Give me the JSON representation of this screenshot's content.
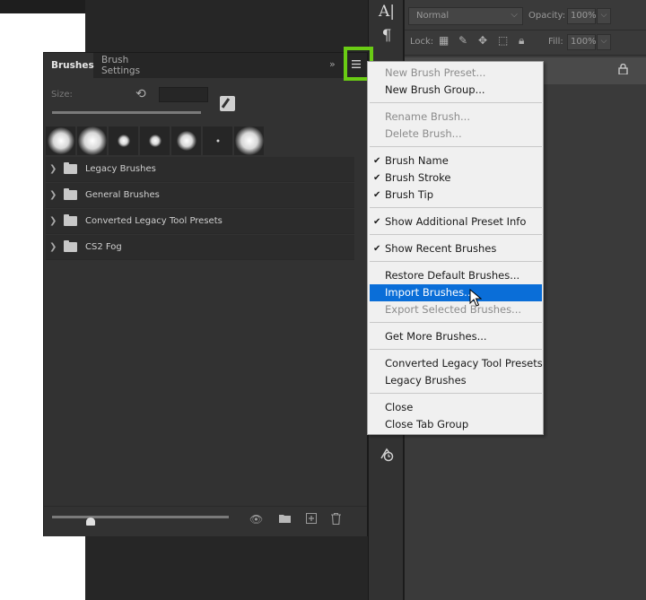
{
  "layers_panel": {
    "blend_mode": "Normal",
    "opacity_label": "Opacity:",
    "opacity_value": "100%",
    "lock_label": "Lock:",
    "fill_label": "Fill:",
    "fill_value": "100%"
  },
  "brushes_panel": {
    "tabs": [
      {
        "label": "Brushes",
        "active": true
      },
      {
        "label": "Brush Settings",
        "active": false
      }
    ],
    "size_label": "Size:",
    "size_value": "",
    "brush_groups": [
      {
        "label": "Legacy Brushes"
      },
      {
        "label": "General Brushes"
      },
      {
        "label": "Converted Legacy Tool Presets"
      },
      {
        "label": "CS2 Fog"
      }
    ]
  },
  "menu": {
    "items": [
      {
        "label": "New Brush Preset...",
        "enabled": false,
        "checked": false
      },
      {
        "label": "New Brush Group...",
        "enabled": true,
        "checked": false
      },
      {
        "label": "Rename Brush...",
        "enabled": false,
        "checked": false
      },
      {
        "label": "Delete Brush...",
        "enabled": false,
        "checked": false
      },
      {
        "label": "Brush Name",
        "enabled": true,
        "checked": true
      },
      {
        "label": "Brush Stroke",
        "enabled": true,
        "checked": true
      },
      {
        "label": "Brush Tip",
        "enabled": true,
        "checked": true
      },
      {
        "label": "Show Additional Preset Info",
        "enabled": true,
        "checked": true
      },
      {
        "label": "Show Recent Brushes",
        "enabled": true,
        "checked": true
      },
      {
        "label": "Restore Default Brushes...",
        "enabled": true,
        "checked": false
      },
      {
        "label": "Import Brushes...",
        "enabled": true,
        "checked": false,
        "highlighted": true
      },
      {
        "label": "Export Selected Brushes...",
        "enabled": false,
        "checked": false
      },
      {
        "label": "Get More Brushes...",
        "enabled": true,
        "checked": false
      },
      {
        "label": "Converted Legacy Tool Presets",
        "enabled": true,
        "checked": false
      },
      {
        "label": "Legacy Brushes",
        "enabled": true,
        "checked": false
      },
      {
        "label": "Close",
        "enabled": true,
        "checked": false
      },
      {
        "label": "Close Tab Group",
        "enabled": true,
        "checked": false
      }
    ],
    "check_glyph": "✔"
  },
  "colors": {
    "highlight_outline": "#6acc14",
    "menu_selection": "#0a6ed8"
  },
  "icons": {
    "tool_type": "A|",
    "tool_paragraph": "¶",
    "tool_history": "history-brush-icon"
  }
}
